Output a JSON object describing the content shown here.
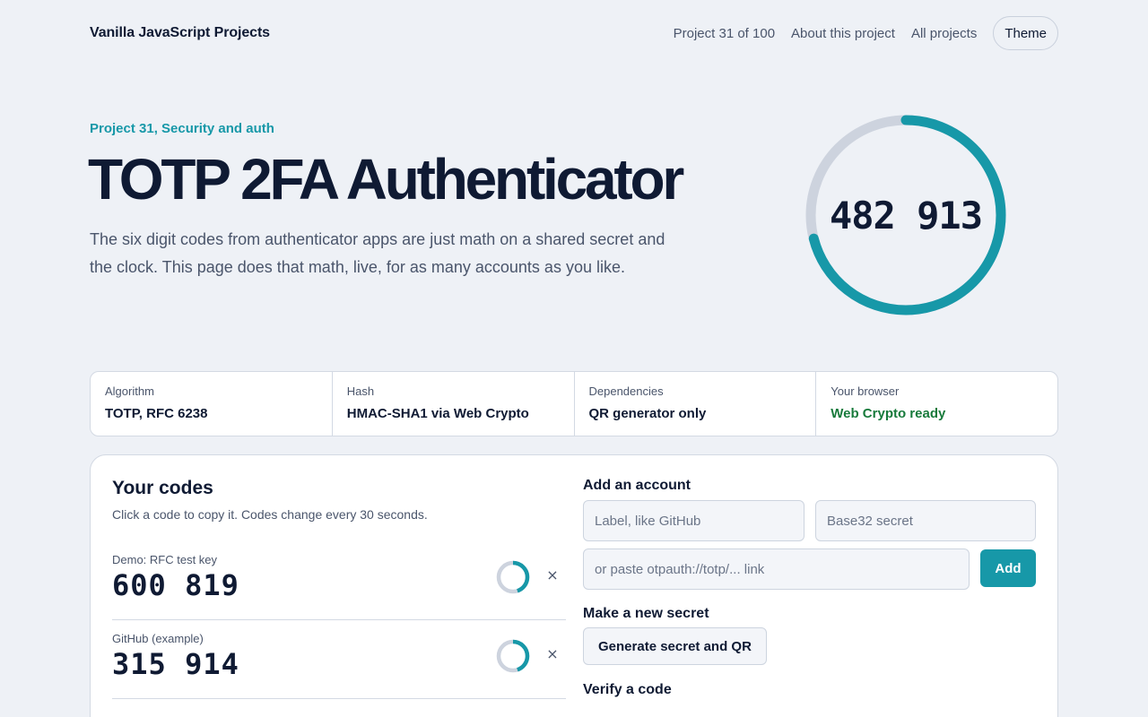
{
  "header": {
    "brand": "Vanilla JavaScript Projects",
    "project_counter": "Project 31 of 100",
    "about_link": "About this project",
    "all_projects_link": "All projects",
    "theme_button": "Theme"
  },
  "hero": {
    "eyebrow": "Project 31, Security and auth",
    "title": "TOTP 2FA Authenticator",
    "description": "The six digit codes from authenticator apps are just math on a shared secret and the clock. This page does that math, live, for as many accounts as you like.",
    "current_code": "482 913",
    "countdown_fraction": 0.71
  },
  "info": [
    {
      "label": "Algorithm",
      "value": "TOTP, RFC 6238"
    },
    {
      "label": "Hash",
      "value": "HMAC-SHA1 via Web Crypto"
    },
    {
      "label": "Dependencies",
      "value": "QR generator only"
    },
    {
      "label": "Your browser",
      "value": "Web Crypto ready"
    }
  ],
  "codes": {
    "title": "Your codes",
    "subtitle": "Click a code to copy it. Codes change every 30 seconds.",
    "accounts": [
      {
        "label": "Demo: RFC test key",
        "code": "600 819",
        "remaining_fraction": 0.45
      },
      {
        "label": "GitHub (example)",
        "code": "315 914",
        "remaining_fraction": 0.45
      }
    ],
    "remove_symbol": "×"
  },
  "add_account": {
    "title": "Add an account",
    "label_placeholder": "Label, like GitHub",
    "secret_placeholder": "Base32 secret",
    "uri_placeholder": "or paste otpauth://totp/... link",
    "add_button": "Add"
  },
  "new_secret": {
    "title": "Make a new secret",
    "button": "Generate secret and QR"
  },
  "verify": {
    "title": "Verify a code"
  },
  "colors": {
    "accent": "#1798a8",
    "track": "#cdd3de",
    "ok": "#177a3b"
  }
}
